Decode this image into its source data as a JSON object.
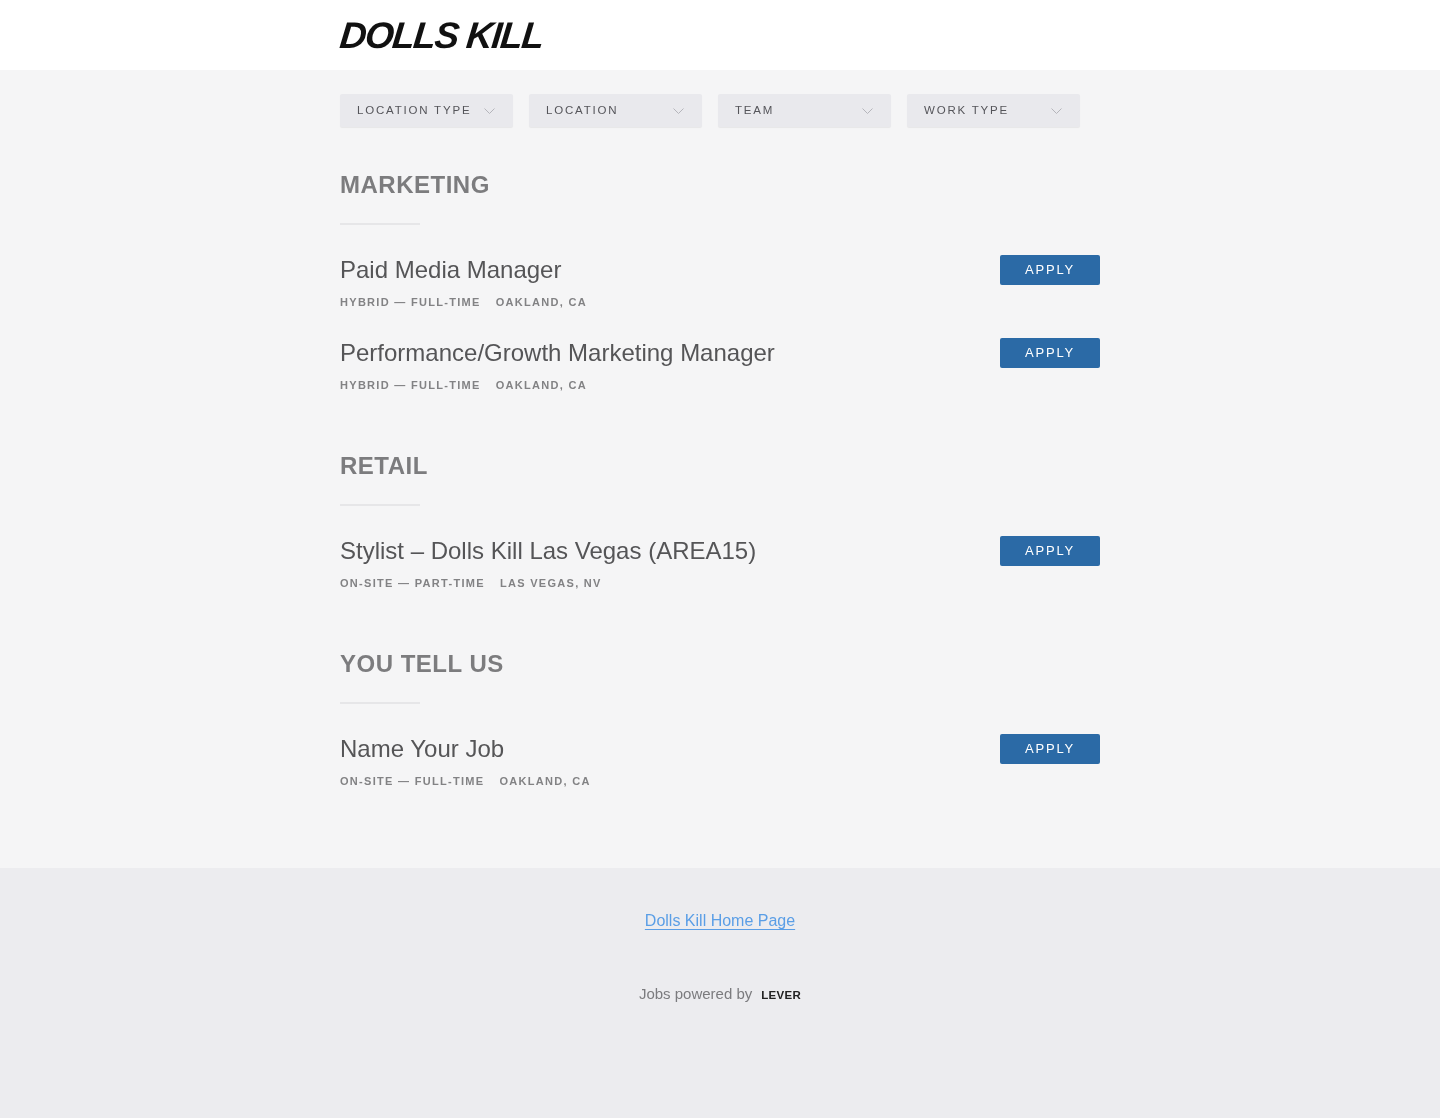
{
  "header": {
    "logo": "DOLLS KILL"
  },
  "filters": [
    {
      "label": "LOCATION TYPE"
    },
    {
      "label": "LOCATION"
    },
    {
      "label": "TEAM"
    },
    {
      "label": "WORK TYPE"
    }
  ],
  "sections": [
    {
      "title": "MARKETING",
      "jobs": [
        {
          "title": "Paid Media Manager",
          "commitment": "HYBRID — FULL-TIME",
          "location": "OAKLAND, CA",
          "button": "APPLY"
        },
        {
          "title": "Performance/Growth Marketing Manager",
          "commitment": "HYBRID — FULL-TIME",
          "location": "OAKLAND, CA",
          "button": "APPLY"
        }
      ]
    },
    {
      "title": "RETAIL",
      "jobs": [
        {
          "title": "Stylist – Dolls Kill Las Vegas (AREA15)",
          "commitment": "ON-SITE — PART-TIME",
          "location": "LAS VEGAS, NV",
          "button": "APPLY"
        }
      ]
    },
    {
      "title": "YOU TELL US",
      "jobs": [
        {
          "title": "Name Your Job",
          "commitment": "ON-SITE — FULL-TIME",
          "location": "OAKLAND, CA",
          "button": "APPLY"
        }
      ]
    }
  ],
  "footer": {
    "link": "Dolls Kill Home Page",
    "powered_by": "Jobs powered by",
    "brand": "LEVER"
  }
}
